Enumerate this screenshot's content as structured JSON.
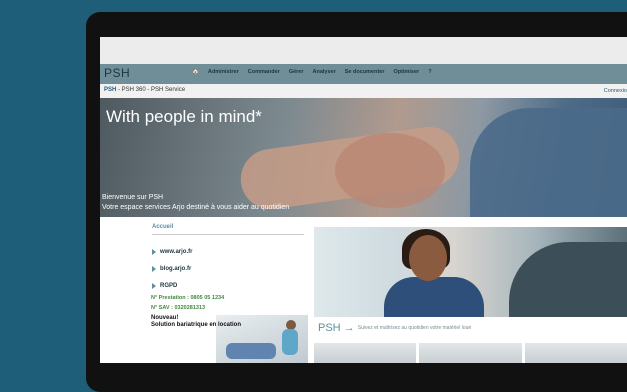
{
  "logo": "PSH",
  "nav": [
    "Administrer",
    "Commander",
    "Gérer",
    "Analyser",
    "Se documenter",
    "Optimiser",
    "?"
  ],
  "breadcrumb": {
    "brand": "PSH",
    "trail": " - PSH 360 - PSH Service"
  },
  "connexion": "Connexio",
  "hero": {
    "title": "With people in mind*",
    "welcome": "Bienvenue sur PSH",
    "subtitle": "Votre espace services Arjo destiné à vous aider au quotidien"
  },
  "sidebar": {
    "heading": "Accueil",
    "links": [
      "www.arjo.fr",
      "blog.arjo.fr",
      "RGPD"
    ],
    "prestation": "N° Prestation : 0805 05 1234",
    "sav": "N° SAV : 0320281313",
    "promo": {
      "line1": "Nouveau!",
      "line2": "Solution bariatrique en location"
    }
  },
  "main": {
    "psh": "PSH",
    "tagline": "Suivez et maîtrisez au quotidien votre matériel loué"
  },
  "colors": {
    "accent": "#5d8f9f",
    "nav_bg": "#6f8e98",
    "background": "#1f5e78",
    "phone_green": "#3f8a3f"
  }
}
